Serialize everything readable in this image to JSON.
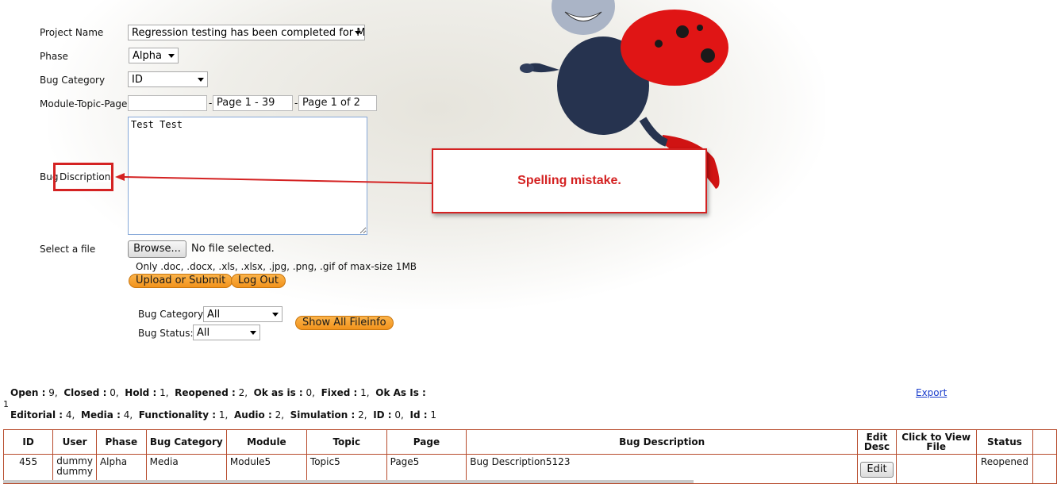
{
  "form": {
    "project_name_label": "Project Name",
    "project_name_value": "Regression testing has been completed for Mo",
    "phase_label": "Phase",
    "phase_value": "Alpha",
    "bug_category_label": "Bug Category",
    "bug_category_value": "ID",
    "module_label": "Module-Topic-Page",
    "module_value": "",
    "topic_value": "Page 1 - 39",
    "page_value": "Page 1 of 2",
    "separator": "-",
    "bug_desc_label_prefix": "Bug",
    "bug_desc_label_highlight": "Discription",
    "bug_desc_value": "Test Test",
    "select_file_label": "Select a file",
    "browse_label": "Browse...",
    "no_file_text": "No file selected.",
    "file_hint": "Only .doc, .docx, .xls, .xlsx, .jpg, .png, .gif of max-size 1MB",
    "upload_label": "Upload or Submit",
    "logout_label": "Log Out"
  },
  "filters": {
    "category_label": "Bug Category:",
    "category_value": "All",
    "status_label": "Bug Status:",
    "status_value": "All",
    "show_all_label": "Show All Fileinfo"
  },
  "callout": {
    "text": "Spelling mistake."
  },
  "stats": {
    "line1": [
      {
        "k": "Open :",
        "v": " 9,"
      },
      {
        "k": "Closed :",
        "v": " 0,"
      },
      {
        "k": "Hold :",
        "v": " 1,"
      },
      {
        "k": "Reopened :",
        "v": " 2,"
      },
      {
        "k": "Ok as is :",
        "v": " 0,"
      },
      {
        "k": "Fixed :",
        "v": " 1,"
      },
      {
        "k": "Ok As Is :",
        "v": ""
      }
    ],
    "stray": "1",
    "line2": [
      {
        "k": "Editorial :",
        "v": " 4,"
      },
      {
        "k": "Media :",
        "v": " 4,"
      },
      {
        "k": "Functionality :",
        "v": " 1,"
      },
      {
        "k": "Audio :",
        "v": " 2,"
      },
      {
        "k": "Simulation :",
        "v": " 2,"
      },
      {
        "k": "ID :",
        "v": " 0,"
      },
      {
        "k": "Id :",
        "v": " 1"
      }
    ],
    "export_label": "Export"
  },
  "table": {
    "headers": {
      "id": "ID",
      "user": "User",
      "phase": "Phase",
      "category": "Bug Category",
      "module": "Module",
      "topic": "Topic",
      "page": "Page",
      "description": "Bug Description",
      "edit": "Edit Desc",
      "view": "Click to View File",
      "status": "Status"
    },
    "row": {
      "id": "455",
      "user": "dummy dummy",
      "phase": "Alpha",
      "category": "Media",
      "module": "Module5",
      "topic": "Topic5",
      "page": "Page5",
      "description": "Bug Description5123",
      "edit_button": "Edit",
      "view": "",
      "status": "Reopened"
    }
  },
  "colors": {
    "annotation_red": "#d42222",
    "button_orange": "#f2931c",
    "table_border": "#b74b2c",
    "link_blue": "#1a3dcc"
  }
}
